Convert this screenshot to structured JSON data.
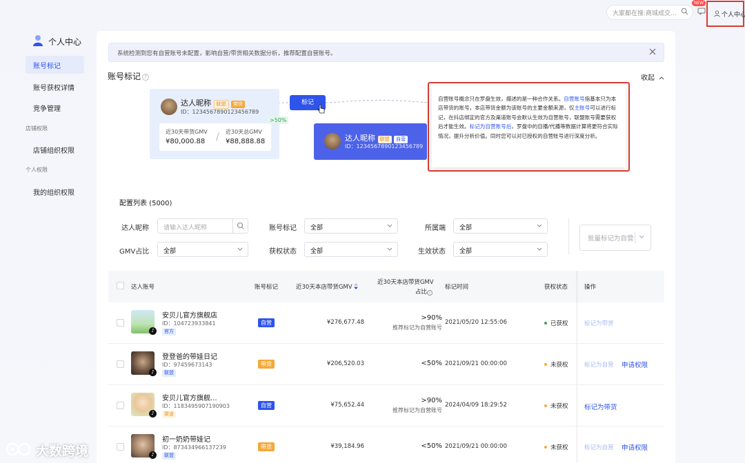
{
  "header": {
    "search_placeholder": "大家都在搜:商城成交...",
    "new_badge": "NEW",
    "user_label": "个人中心"
  },
  "sidebar": {
    "title": "个人中心",
    "items": [
      {
        "label": "账号标记",
        "active": true
      },
      {
        "label": "账号获权详情"
      },
      {
        "label": "竞争管理"
      }
    ],
    "group_shop": "店铺权限",
    "shop_items": [
      {
        "label": "店铺组织权限"
      }
    ],
    "group_personal": "个人权限",
    "personal_items": [
      {
        "label": "我的组织权限"
      }
    ]
  },
  "alert": {
    "text": "系统检测到您有自营账号未配置，影响自营/带货相关数据分析，推荐配置自营账号。"
  },
  "section": {
    "title": "账号标记",
    "collapse_label": "收起"
  },
  "demo": {
    "left_card": {
      "nickname": "达人昵称",
      "tag_lm": "联盟",
      "tag_dh": "带货",
      "id": "ID：1234567890123456789",
      "gmv30_label": "近30天带货GMV",
      "gmv30_value": "¥80,000.88",
      "total_label": "近30天总GMV",
      "total_value": "¥88,888.88"
    },
    "pct_label": ">50%",
    "mark_button": "标记",
    "right_card": {
      "nickname": "达人昵称",
      "tag_lm": "联盟",
      "tag_zy": "自营",
      "id": "ID：1234567890123456789"
    }
  },
  "tooltip": {
    "p1": "自营账号概念只在罗盘生效，描述的是一种合作关系。",
    "h1": "自营账号",
    "p2": "指基本只为本店带货的账号，本店带货金额为该账号的主要金额来源，仅",
    "h2": "主账号",
    "p3": "可以进行标记，在抖店绑定的官方及渠道账号会默认生效为自营账号，联盟账号需要获权后才能生效。",
    "h3": "标记为自营账号后",
    "p4": "，罗盘中的自播/代播等数据计算将更符合实际情况，提升分析价值。同时您可以对已授权的自营账号进行深度分析。"
  },
  "filters": {
    "list_title": "配置列表 (5000)",
    "nickname_label": "达人昵称",
    "nickname_placeholder": "请输入达人昵称",
    "mark_label": "账号标记",
    "mark_value": "全部",
    "belong_label": "所属端",
    "belong_value": "全部",
    "gmv_label": "GMV占比",
    "gmv_value": "全部",
    "auth_label": "获权状态",
    "auth_value": "全部",
    "effect_label": "生效状态",
    "effect_value": "全部",
    "batch_button": "批量标记为自营"
  },
  "table": {
    "headers": {
      "account": "达人账号",
      "mark": "账号标记",
      "gmv": "近30天本店带货GMV",
      "ratio_l1": "近30天本店带货GMV",
      "ratio_l2": "占比",
      "time": "标记时间",
      "auth": "获权状态",
      "op": "操作"
    },
    "rows": [
      {
        "name": "安贝儿官方旗舰店",
        "id": "ID：104723933841",
        "channel": "官方",
        "mark": "自营",
        "gmv": "¥276,677.48",
        "ratio": ">90%",
        "ratio_sub": "推荐标记为自营账号",
        "time": "2021/05/20 12:55:06",
        "auth": "已获权",
        "op1": "标记为带货",
        "op2": ""
      },
      {
        "name": "登登爸的带娃日记",
        "id": "ID：97459673143",
        "channel": "联盟",
        "mark": "带货",
        "gmv": "¥206,520.03",
        "ratio": "<50%",
        "ratio_sub": "",
        "time": "2021/09/21 00:00:00",
        "auth": "未获权",
        "op1": "标记为自营",
        "op2": "申请权限"
      },
      {
        "name": "安贝儿官方旗舰...",
        "id": "ID：1183495907190903",
        "channel": "渠道",
        "mark": "自营",
        "gmv": "¥75,652.44",
        "ratio": ">90%",
        "ratio_sub": "推荐标记为自营账号",
        "time": "2024/04/09 18:29:52",
        "auth": "未获权",
        "op1": "标记为带货",
        "op2": ""
      },
      {
        "name": "初一奶奶带娃记",
        "id": "ID：873434966137239",
        "channel": "联盟",
        "mark": "带货",
        "gmv": "¥39,184.96",
        "ratio": "<50%",
        "ratio_sub": "",
        "time": "2021/09/21 00:00:00",
        "auth": "未获权",
        "op1": "标记为自营",
        "op2": "申请权限"
      }
    ]
  },
  "brand": {
    "text": "大数跨境"
  },
  "colors": {
    "primary": "#2f54eb",
    "annotation_red": "#d93a30",
    "ok_green": "#39a25d",
    "warn_orange": "#f4a93a"
  }
}
